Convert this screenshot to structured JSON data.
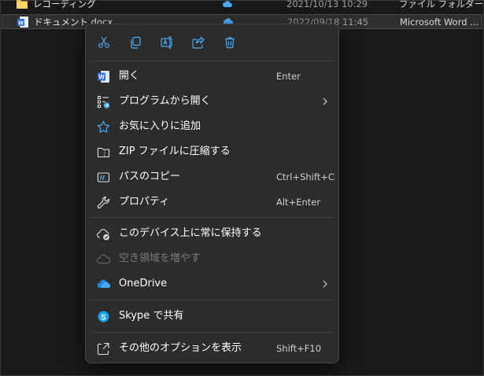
{
  "files": [
    {
      "name": "レコーディング",
      "date": "2021/10/13 10:29",
      "type": "ファイル フォルダー",
      "icon": "folder-icon"
    },
    {
      "name": "ドキュメント.docx",
      "date": "2022/09/18 11:45",
      "type": "Microsoft Word ...",
      "icon": "word-doc-icon"
    }
  ],
  "menu": {
    "toolbar": [
      {
        "action": "cut",
        "icon": "scissors-icon"
      },
      {
        "action": "copy",
        "icon": "copy-icon"
      },
      {
        "action": "rename",
        "icon": "rename-icon"
      },
      {
        "action": "share",
        "icon": "share-icon"
      },
      {
        "action": "delete",
        "icon": "trash-icon"
      }
    ],
    "items": [
      {
        "label": "開く",
        "shortcut": "Enter",
        "icon": "word-icon"
      },
      {
        "label": "プログラムから開く",
        "shortcut": "",
        "icon": "open-with-icon",
        "submenu": true
      },
      {
        "label": "お気に入りに追加",
        "shortcut": "",
        "icon": "star-icon"
      },
      {
        "label": "ZIP ファイルに圧縮する",
        "shortcut": "",
        "icon": "zip-icon"
      },
      {
        "label": "パスのコピー",
        "shortcut": "Ctrl+Shift+C",
        "icon": "copy-path-icon"
      },
      {
        "label": "プロパティ",
        "shortcut": "Alt+Enter",
        "icon": "wrench-icon"
      },
      {
        "label": "このデバイス上に常に保持する",
        "shortcut": "",
        "icon": "cloud-sync-icon"
      },
      {
        "label": "空き領域を増やす",
        "shortcut": "",
        "icon": "cloud-outline-icon",
        "disabled": true
      },
      {
        "label": "OneDrive",
        "shortcut": "",
        "icon": "onedrive-icon",
        "submenu": true
      },
      {
        "label": "Skype で共有",
        "shortcut": "",
        "icon": "skype-icon"
      },
      {
        "label": "その他のオプションを表示",
        "shortcut": "Shift+F10",
        "icon": "more-options-icon"
      }
    ]
  },
  "colors": {
    "background": "#191919",
    "menu_bg": "#2c2c2c",
    "accent_blue": "#4ca8f5",
    "word_blue": "#2b6bd6",
    "folder_yellow": "#f2c94c"
  }
}
